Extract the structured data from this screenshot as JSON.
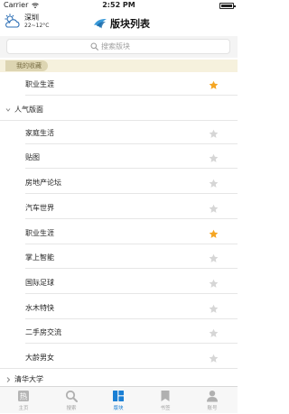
{
  "status_bar": {
    "carrier": "Carrier",
    "time": "2:52 PM"
  },
  "weather": {
    "city": "深圳",
    "temp": "22~12°C"
  },
  "nav": {
    "title": "版块列表"
  },
  "search": {
    "placeholder": "搜索版块"
  },
  "favorites": {
    "header": "我的收藏",
    "items": [
      {
        "label": "职业生涯",
        "starred": true
      }
    ]
  },
  "sections": [
    {
      "title": "人气版面",
      "items": [
        {
          "label": "家庭生活",
          "starred": false
        },
        {
          "label": "贴图",
          "starred": false
        },
        {
          "label": "房地产论坛",
          "starred": false
        },
        {
          "label": "汽车世界",
          "starred": false
        },
        {
          "label": "职业生涯",
          "starred": true
        },
        {
          "label": "掌上智能",
          "starred": false
        },
        {
          "label": "国际足球",
          "starred": false
        },
        {
          "label": "水木特快",
          "starred": false
        },
        {
          "label": "二手房交流",
          "starred": false
        },
        {
          "label": "大龄男女",
          "starred": false
        }
      ]
    },
    {
      "title": "清华大学",
      "items": []
    }
  ],
  "tab_bar": [
    {
      "label": "主页",
      "icon": "hot-icon",
      "active": false
    },
    {
      "label": "搜索",
      "icon": "search-icon",
      "active": false
    },
    {
      "label": "版块",
      "icon": "boards-icon",
      "active": true
    },
    {
      "label": "书签",
      "icon": "bookmark-icon",
      "active": false
    },
    {
      "label": "账号",
      "icon": "person-icon",
      "active": false
    }
  ],
  "colors": {
    "accent": "#1a7fd4",
    "star_on": "#f5a623",
    "star_off": "#d6d6d6",
    "fav_header_bg": "#f6f1dd",
    "fav_tab_bg": "#ddd5b2",
    "tab_inactive": "#a3a3a3"
  }
}
